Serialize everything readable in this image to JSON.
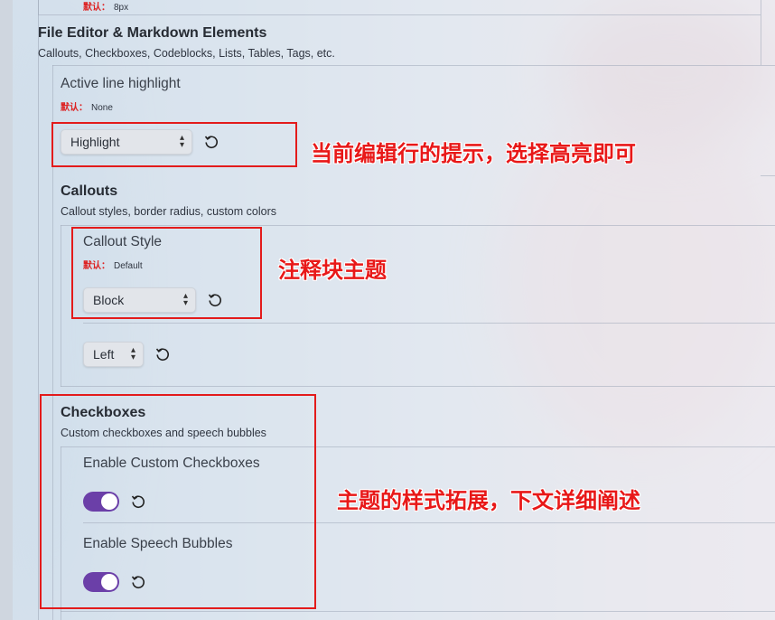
{
  "top_default": {
    "label": "默认：",
    "value": "8px"
  },
  "section": {
    "title": "File Editor & Markdown Elements",
    "subtitle": "Callouts, Checkboxes, Codeblocks, Lists, Tables, Tags, etc."
  },
  "active_line": {
    "name": "Active line highlight",
    "default_label": "默认：",
    "default_value": "None",
    "select_value": "Highlight"
  },
  "callouts": {
    "title": "Callouts",
    "subtitle": "Callout styles, border radius, custom colors",
    "style_name": "Callout Style",
    "default_label": "默认：",
    "default_value": "Default",
    "style_value": "Block",
    "align_value": "Left"
  },
  "checkboxes": {
    "title": "Checkboxes",
    "subtitle": "Custom checkboxes and speech bubbles",
    "custom_name": "Enable Custom Checkboxes",
    "custom_enabled": true,
    "bubbles_name": "Enable Speech Bubbles",
    "bubbles_enabled": true
  },
  "annotations": {
    "active_line_note": "当前编辑行的提示，选择高亮即可",
    "callout_note": "注释块主题",
    "checkbox_note": "主题的样式拓展，下文详细阐述"
  },
  "colors": {
    "accent": "#6b3fa8",
    "annotation": "#e31b1b"
  },
  "icons": {
    "reset": "reset-icon",
    "chevron": "chevron-updown-icon"
  }
}
